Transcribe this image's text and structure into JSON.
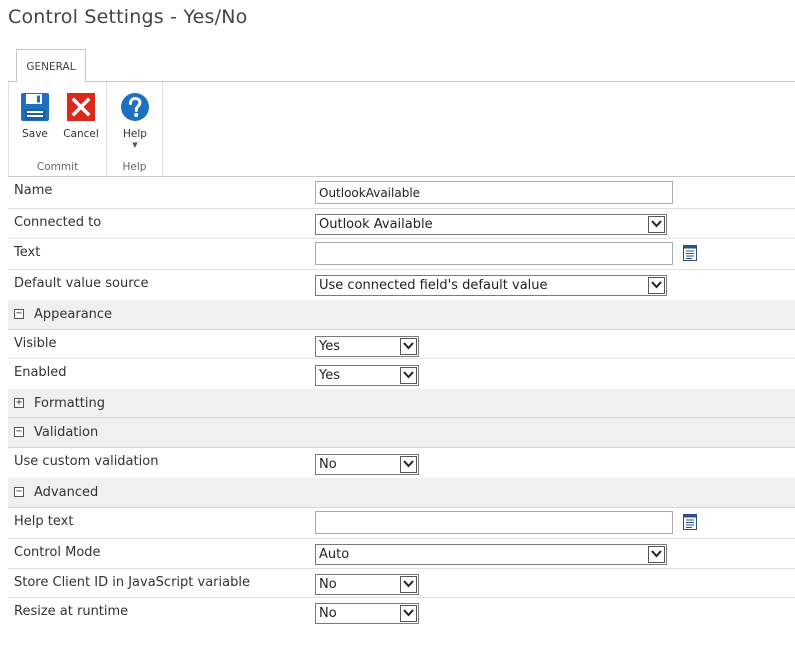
{
  "page": {
    "title": "Control Settings - Yes/No"
  },
  "ribbon": {
    "tab": "GENERAL",
    "groups": {
      "commit": {
        "label": "Commit",
        "save": "Save",
        "cancel": "Cancel"
      },
      "help": {
        "label": "Help",
        "help": "Help"
      }
    }
  },
  "fields": {
    "name": {
      "label": "Name",
      "value": "OutlookAvailable"
    },
    "connected_to": {
      "label": "Connected to",
      "value": "Outlook Available"
    },
    "text": {
      "label": "Text",
      "value": ""
    },
    "default_value_source": {
      "label": "Default value source",
      "value": "Use connected field's default value"
    }
  },
  "appearance": {
    "title": "Appearance",
    "toggle": "−",
    "visible": {
      "label": "Visible",
      "value": "Yes"
    },
    "enabled": {
      "label": "Enabled",
      "value": "Yes"
    }
  },
  "formatting": {
    "title": "Formatting",
    "toggle": "+"
  },
  "validation": {
    "title": "Validation",
    "toggle": "−",
    "use_custom_validation": {
      "label": "Use custom validation",
      "value": "No"
    }
  },
  "advanced": {
    "title": "Advanced",
    "toggle": "−",
    "help_text": {
      "label": "Help text",
      "value": ""
    },
    "control_mode": {
      "label": "Control Mode",
      "value": "Auto"
    },
    "store_client_id": {
      "label": "Store Client ID in JavaScript variable",
      "value": "No"
    },
    "resize_at_runtime": {
      "label": "Resize at runtime",
      "value": "No"
    }
  },
  "colors": {
    "save_blue": "#1f6fc0",
    "cancel_red": "#d9291c",
    "help_blue": "#1e6fbf",
    "section_bg": "#f0f0f0"
  },
  "icons": [
    "save-icon",
    "cancel-icon",
    "help-icon",
    "document-icon",
    "chevron-down-icon"
  ]
}
